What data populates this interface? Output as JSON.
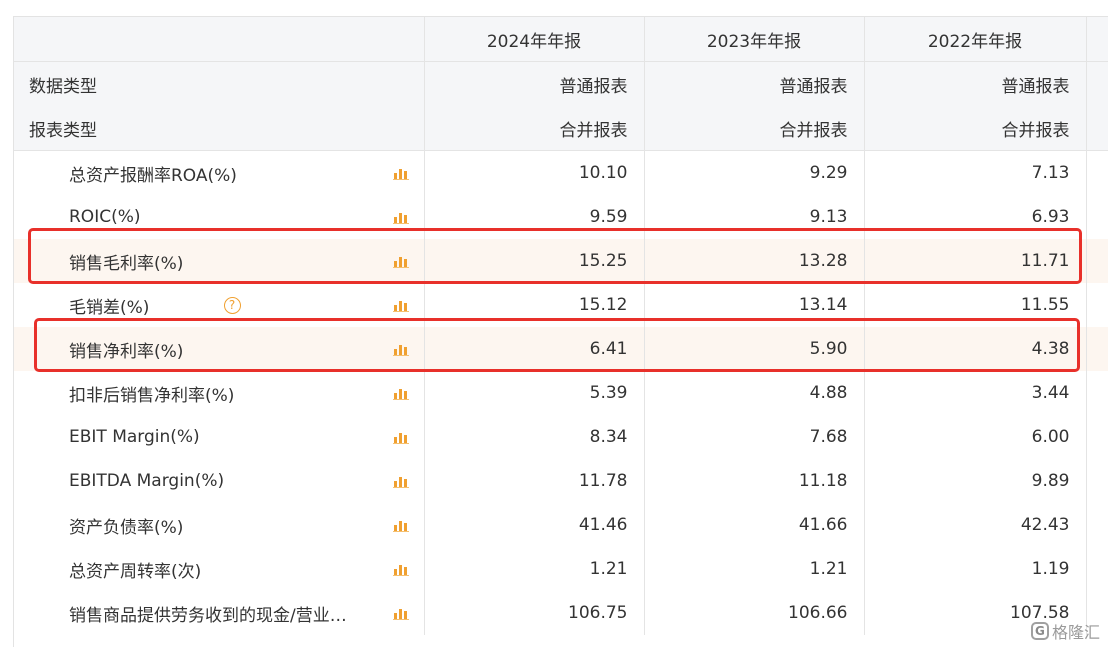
{
  "header": {
    "corner": "",
    "col1": "2024年年报",
    "col2": "2023年年报",
    "col3": "2022年年报"
  },
  "meta_rows": [
    {
      "label": "数据类型",
      "values": [
        "普通报表",
        "普通报表",
        "普通报表"
      ]
    },
    {
      "label": "报表类型",
      "values": [
        "合并报表",
        "合并报表",
        "合并报表"
      ]
    }
  ],
  "rows": [
    {
      "label": "总资产报酬率ROA(%)",
      "values": [
        "10.10",
        "9.29",
        "7.13"
      ],
      "highlighted": false,
      "help": false
    },
    {
      "label": "ROIC(%)",
      "values": [
        "9.59",
        "9.13",
        "6.93"
      ],
      "highlighted": false,
      "help": false
    },
    {
      "label": "销售毛利率(%)",
      "values": [
        "15.25",
        "13.28",
        "11.71"
      ],
      "highlighted": true,
      "help": false
    },
    {
      "label": "毛销差(%)",
      "values": [
        "15.12",
        "13.14",
        "11.55"
      ],
      "highlighted": false,
      "help": true
    },
    {
      "label": "销售净利率(%)",
      "values": [
        "6.41",
        "5.90",
        "4.38"
      ],
      "highlighted": true,
      "help": false
    },
    {
      "label": "扣非后销售净利率(%)",
      "values": [
        "5.39",
        "4.88",
        "3.44"
      ],
      "highlighted": false,
      "help": false
    },
    {
      "label": "EBIT Margin(%)",
      "values": [
        "8.34",
        "7.68",
        "6.00"
      ],
      "highlighted": false,
      "help": false
    },
    {
      "label": "EBITDA Margin(%)",
      "values": [
        "11.78",
        "11.18",
        "9.89"
      ],
      "highlighted": false,
      "help": false
    },
    {
      "label": "资产负债率(%)",
      "values": [
        "41.46",
        "41.66",
        "42.43"
      ],
      "highlighted": false,
      "help": false
    },
    {
      "label": "总资产周转率(次)",
      "values": [
        "1.21",
        "1.21",
        "1.19"
      ],
      "highlighted": false,
      "help": false
    },
    {
      "label": "销售商品提供劳务收到的现金/营业…",
      "values": [
        "106.75",
        "106.66",
        "107.58"
      ],
      "highlighted": false,
      "help": false
    }
  ],
  "help_icon_glyph": "?",
  "watermark": {
    "logo": "G",
    "text": "格隆汇"
  },
  "colors": {
    "accent_orange": "#f0a030",
    "highlight_border": "#e8302a",
    "header_bg": "#f5f6f8"
  },
  "icons": {
    "row_chart": "bar-chart-icon",
    "help": "help-icon"
  }
}
